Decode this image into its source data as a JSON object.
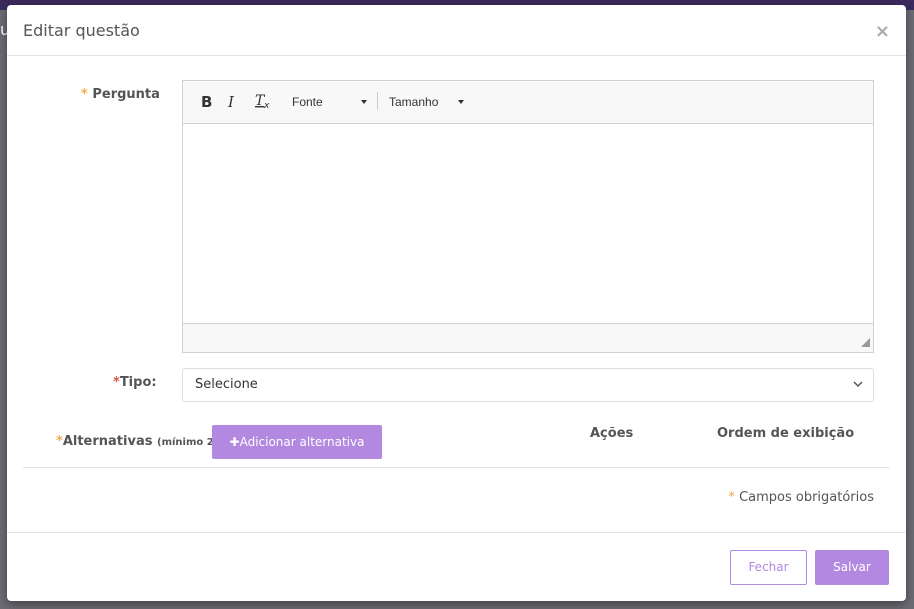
{
  "backdrop": {
    "partial_text": "u"
  },
  "modal": {
    "title": "Editar questão",
    "close_symbol": "×"
  },
  "form": {
    "required_mark": "*",
    "pergunta_label": "Pergunta",
    "editor": {
      "bold": "B",
      "italic": "I",
      "clear_format": "Tx",
      "font_combo": "Fonte",
      "size_combo": "Tamanho"
    },
    "tipo_label": "Tipo:",
    "tipo_select": {
      "selected": "Selecione"
    },
    "alternativas_label": "Alternativas",
    "alternativas_hint": "(mínimo 2)",
    "add_alternative_label": "✚Adicionar alternativa",
    "table_headers": [
      "Ações",
      "Ordem de exibição"
    ],
    "required_note": "Campos obrigatórios"
  },
  "footer": {
    "close_label": "Fechar",
    "save_label": "Salvar"
  },
  "colors": {
    "accent": "#b388e0",
    "required_orange": "#f0ad4e",
    "required_red": "#d9534f"
  }
}
